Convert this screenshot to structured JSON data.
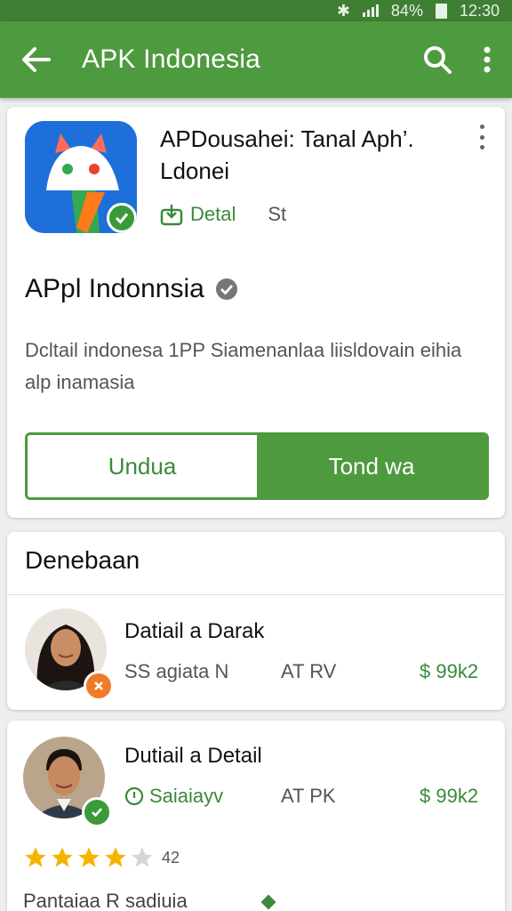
{
  "status_bar": {
    "battery_percent": "84%",
    "time": "12:30"
  },
  "app_bar": {
    "title": "APK Indonesia"
  },
  "app_card": {
    "title": "APDousahei: Tanal Aph’. Ldonei",
    "detail_label": "Detal",
    "extra_label": "St",
    "app_name": "APpl Indonnsia",
    "description": "Dcltail indonesa 1PP Siamenanlaa liisldovain eihia alp inamasia",
    "button_left": "Undua",
    "button_right": "Tond wa"
  },
  "section": {
    "title": "Denebaan",
    "items": [
      {
        "name": "Datiail a Darak",
        "meta": "SS agiata N",
        "code": "AT RV",
        "price": "$ 99k2",
        "badge": "orange"
      },
      {
        "name": "Dutiail a Detail",
        "meta": "Saiaiayv",
        "code": "AT PK",
        "price": "$ 99k2",
        "badge": "green"
      }
    ]
  },
  "rating": {
    "stars": 4,
    "count": "42"
  },
  "footer_text": "Pantaiaa R sadiuia",
  "colors": {
    "primary": "#4e9a3e",
    "primary_dark": "#3f7f34",
    "accent_text": "#3a8a3a"
  },
  "icons": [
    "arrow-back-icon",
    "search-icon",
    "more-vert-icon",
    "verified-icon",
    "download-icon",
    "star-icon"
  ]
}
